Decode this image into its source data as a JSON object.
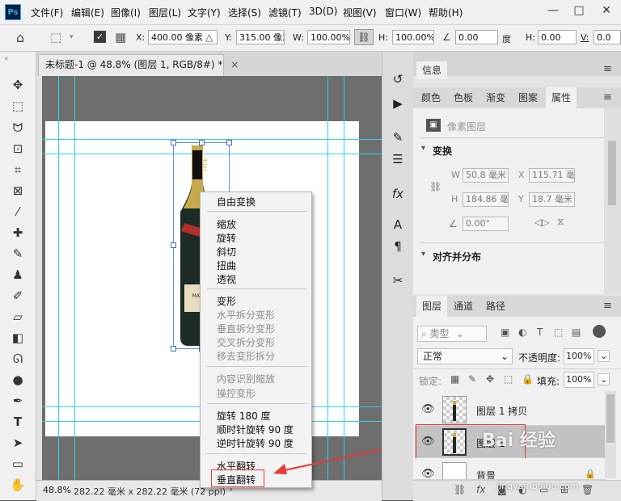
{
  "app": {
    "logo": "Ps",
    "menu": [
      "文件(F)",
      "编辑(E)",
      "图像(I)",
      "图层(L)",
      "文字(Y)",
      "选择(S)",
      "滤镜(T)",
      "3D(D)",
      "视图(V)",
      "窗口(W)",
      "帮助(H)"
    ],
    "win_minimize": "—",
    "win_restore": "□",
    "win_close": "✕"
  },
  "options": {
    "x_label": "X:",
    "x_value": "400.00 像素",
    "y_label": "Y:",
    "y_value": "315.00 像素",
    "w_label": "W:",
    "w_value": "100.00%",
    "h_label": "H:",
    "h_value": "100.00%",
    "angle_value": "0.00",
    "angle_unit": "度",
    "hskew_label": "H:",
    "hskew_value": "0.00",
    "v_label": "V:",
    "v_value": "0.0"
  },
  "document": {
    "tab_title": "未标题-1 @ 48.8% (图层 1, RGB/8#) *",
    "close": "×",
    "zoom": "48.8%",
    "size": "282.22 毫米 x 282.22 毫米 (72 ppi)",
    "status_arrow": "›",
    "bottle_label": "THIE",
    "bottle_label2": "MATHE"
  },
  "context_menu": {
    "free_transform": "自由变换",
    "group1": [
      "缩放",
      "旋转",
      "斜切",
      "扭曲",
      "透视"
    ],
    "group2": [
      "变形",
      "水平拆分变形",
      "垂直拆分变形",
      "交叉拆分变形",
      "移去变形拆分"
    ],
    "group3": [
      "内容识别缩放",
      "操控变形"
    ],
    "group4": [
      "旋转 180 度",
      "顺时针旋转 90 度",
      "逆时针旋转 90 度"
    ],
    "group5": [
      "水平翻转",
      "垂直翻转"
    ]
  },
  "panels": {
    "info_tab": "信息",
    "tabs2": [
      "颜色",
      "色板",
      "渐变",
      "图案",
      "属性"
    ],
    "pixel_layer": "像素图层",
    "transform_title": "变换",
    "w_label": "W",
    "w_value": "50.8 毫米",
    "x_label": "X",
    "x_value": "115.71 毫米",
    "h_label": "H",
    "h_value": "184.86 毫米",
    "y_label": "Y",
    "y_value": "18.7 毫米",
    "angle_value": "0.00°",
    "align_title": "对齐并分布",
    "layer_tabs": [
      "图层",
      "通道",
      "路径"
    ],
    "filter_kind": "类型",
    "blend_mode": "正常",
    "opacity_label": "不透明度:",
    "opacity_value": "100%",
    "lock_label": "锁定:",
    "fill_label": "填充:",
    "fill_value": "100%",
    "layers": [
      {
        "name": "图层 1 拷贝"
      },
      {
        "name": "图层 1"
      },
      {
        "name": "背景"
      }
    ],
    "watermark": "Bai 经验",
    "watermark_url": "jingyan.baidu.com"
  },
  "annotation_color": "#e53935",
  "guide_color": "#27d7e0",
  "selection_color": "#3f6bd0"
}
